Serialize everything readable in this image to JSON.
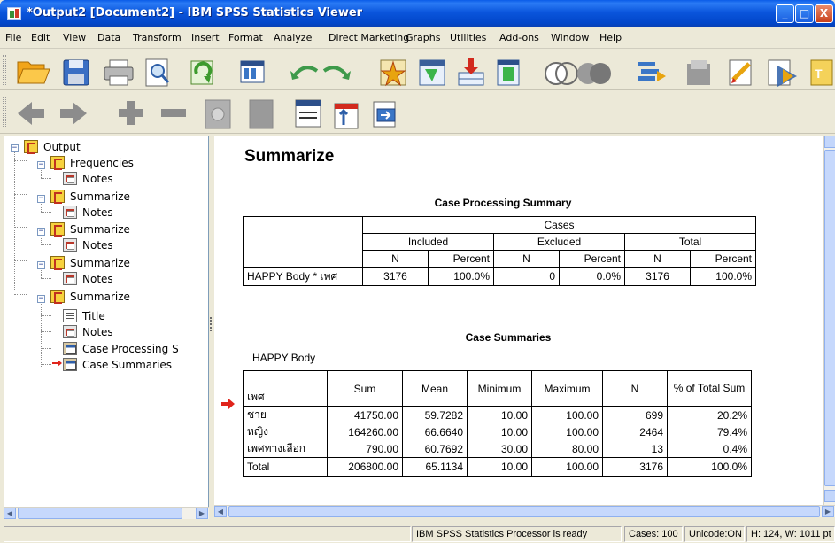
{
  "window": {
    "title": "*Output2 [Document2] - IBM SPSS Statistics Viewer",
    "controls": {
      "minimize": "_",
      "maximize": "□",
      "close": "X"
    }
  },
  "menu": [
    "File",
    "Edit",
    "View",
    "Data",
    "Transform",
    "Insert",
    "Format",
    "Analyze",
    "Direct Marketing",
    "Graphs",
    "Utilities",
    "Add-ons",
    "Window",
    "Help"
  ],
  "toolbar1_icons": [
    "open-icon",
    "save-icon",
    "print-icon",
    "print-preview-icon",
    "export-icon",
    "dialog-recall-icon",
    "undo-icon",
    "redo-icon",
    "goto-case-icon",
    "goto-variable-icon",
    "insert-cases-icon",
    "insert-variable-icon",
    "split-file-icon",
    "weight-cases-icon",
    "select-cases-icon",
    "value-labels-icon",
    "use-sets-icon",
    "show-all-variables-icon",
    "spell-check-icon"
  ],
  "toolbar2_icons": [
    "back-icon",
    "forward-icon",
    "expand-icon",
    "collapse-icon",
    "show-icon",
    "hide-icon",
    "insert-heading-icon",
    "insert-title-icon",
    "insert-text-icon"
  ],
  "tree": {
    "root": "Output",
    "items": [
      {
        "label": "Frequencies",
        "type": "book",
        "children": [
          "Notes"
        ]
      },
      {
        "label": "Summarize",
        "type": "book",
        "children": [
          "Notes"
        ]
      },
      {
        "label": "Summarize",
        "type": "book",
        "children": [
          "Notes"
        ]
      },
      {
        "label": "Summarize",
        "type": "book",
        "children": [
          "Notes"
        ]
      },
      {
        "label": "Summarize",
        "type": "book",
        "children": [
          "Title",
          "Notes",
          "Case Processing S",
          "Case Summaries"
        ]
      }
    ]
  },
  "content": {
    "heading": "Summarize",
    "case_processing": {
      "title": "Case Processing Summary",
      "group": "Cases",
      "subgroups": [
        "Included",
        "Excluded",
        "Total"
      ],
      "cols": [
        "N",
        "Percent",
        "N",
        "Percent",
        "N",
        "Percent"
      ],
      "row_label": "HAPPY Body * เพศ",
      "values": [
        "3176",
        "100.0%",
        "0",
        "0.0%",
        "3176",
        "100.0%"
      ]
    },
    "case_summaries": {
      "title": "Case Summaries",
      "variable": "HAPPY Body",
      "headers": [
        "เพศ",
        "Sum",
        "Mean",
        "Minimum",
        "Maximum",
        "N",
        "% of Total Sum"
      ],
      "rows": [
        [
          "ชาย",
          "41750.00",
          "59.7282",
          "10.00",
          "100.00",
          "699",
          "20.2%"
        ],
        [
          "หญิง",
          "164260.00",
          "66.6640",
          "10.00",
          "100.00",
          "2464",
          "79.4%"
        ],
        [
          "เพศทางเลือก",
          "790.00",
          "60.7692",
          "30.00",
          "80.00",
          "13",
          "0.4%"
        ],
        [
          "Total",
          "206800.00",
          "65.1134",
          "10.00",
          "100.00",
          "3176",
          "100.0%"
        ]
      ]
    }
  },
  "status": {
    "processor": "IBM SPSS Statistics Processor is ready",
    "cases": "Cases: 100",
    "unicode": "Unicode:ON",
    "size": "H: 124, W: 1011 pt"
  },
  "colors": {
    "title_bar": "#0a55dc",
    "selection_arrow": "#e0241b"
  }
}
